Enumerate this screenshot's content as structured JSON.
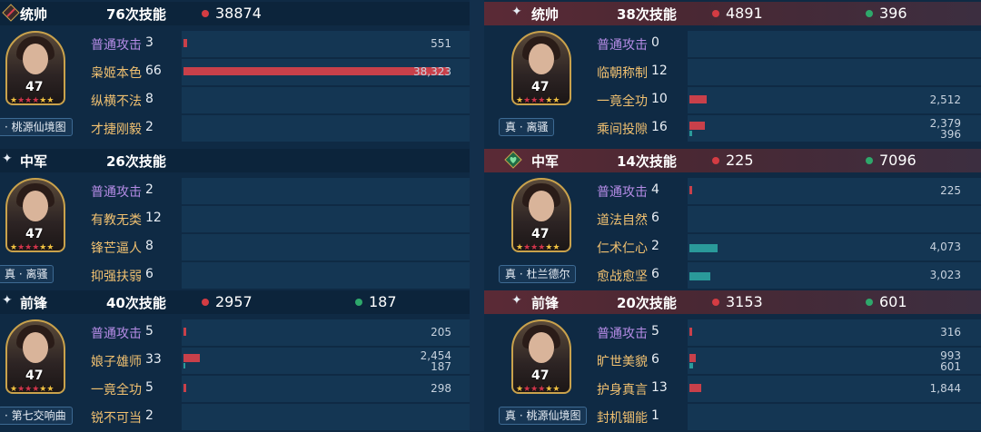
{
  "left": {
    "sections": [
      {
        "role": "统帅",
        "count": "76次技能",
        "red": "38874",
        "green": "",
        "hero": {
          "level": "47",
          "name": "· 桃源仙境图"
        },
        "skills": [
          {
            "name": "普通攻击",
            "count": "3",
            "v1": "551",
            "v2": "",
            "red": 0.013,
            "green": 0
          },
          {
            "name": "枭姬本色",
            "count": "66",
            "v1": "38,323",
            "v2": "",
            "red": 0.95,
            "green": 0
          },
          {
            "name": "纵横不法",
            "count": "8",
            "v1": "",
            "v2": "",
            "red": 0,
            "green": 0
          },
          {
            "name": "才捷刚毅",
            "count": "2",
            "v1": "",
            "v2": "",
            "red": 0,
            "green": 0
          }
        ]
      },
      {
        "role": "中军",
        "count": "26次技能",
        "red": "",
        "green": "",
        "hero": {
          "level": "47",
          "name": "真 · 离骚"
        },
        "skills": [
          {
            "name": "普通攻击",
            "count": "2",
            "v1": "",
            "v2": "",
            "red": 0,
            "green": 0
          },
          {
            "name": "有教无类",
            "count": "12",
            "v1": "",
            "v2": "",
            "red": 0,
            "green": 0
          },
          {
            "name": "锋芒逼人",
            "count": "8",
            "v1": "",
            "v2": "",
            "red": 0,
            "green": 0
          },
          {
            "name": "抑强扶弱",
            "count": "6",
            "v1": "",
            "v2": "",
            "red": 0,
            "green": 0
          }
        ]
      },
      {
        "role": "前锋",
        "count": "40次技能",
        "red": "2957",
        "green": "187",
        "hero": {
          "level": "47",
          "name": "· 第七交响曲"
        },
        "skills": [
          {
            "name": "普通攻击",
            "count": "5",
            "v1": "205",
            "v2": "",
            "red": 0.005,
            "green": 0
          },
          {
            "name": "娘子雄师",
            "count": "33",
            "v1": "2,454",
            "v2": "187",
            "red": 0.06,
            "green": 0.005
          },
          {
            "name": "一竟全功",
            "count": "5",
            "v1": "298",
            "v2": "",
            "red": 0.007,
            "green": 0
          },
          {
            "name": "锐不可当",
            "count": "2",
            "v1": "",
            "v2": "",
            "red": 0,
            "green": 0
          }
        ]
      }
    ]
  },
  "right": {
    "sections": [
      {
        "role": "统帅",
        "count": "38次技能",
        "red": "4891",
        "green": "396",
        "hero": {
          "level": "47",
          "name": "真 · 离骚"
        },
        "skills": [
          {
            "name": "普通攻击",
            "count": "0",
            "v1": "",
            "v2": "",
            "red": 0,
            "green": 0
          },
          {
            "name": "临朝称制",
            "count": "12",
            "v1": "",
            "v2": "",
            "red": 0,
            "green": 0
          },
          {
            "name": "一竟全功",
            "count": "10",
            "v1": "2,512",
            "v2": "",
            "red": 0.06,
            "green": 0
          },
          {
            "name": "乘间投隙",
            "count": "16",
            "v1": "2,379",
            "v2": "396",
            "red": 0.055,
            "green": 0.008
          }
        ]
      },
      {
        "role": "中军",
        "count": "14次技能",
        "red": "225",
        "green": "7096",
        "hero": {
          "level": "47",
          "name": "真 · 杜兰德尔"
        },
        "skills": [
          {
            "name": "普通攻击",
            "count": "4",
            "v1": "225",
            "v2": "",
            "red": 0.005,
            "green": 0
          },
          {
            "name": "道法自然",
            "count": "6",
            "v1": "",
            "v2": "",
            "red": 0,
            "green": 0
          },
          {
            "name": "仁术仁心",
            "count": "2",
            "v1": "4,073",
            "v2": "",
            "red": 0,
            "green": 0.1
          },
          {
            "name": "愈战愈坚",
            "count": "6",
            "v1": "3,023",
            "v2": "",
            "red": 0,
            "green": 0.075
          }
        ]
      },
      {
        "role": "前锋",
        "count": "20次技能",
        "red": "3153",
        "green": "601",
        "hero": {
          "level": "47",
          "name": "真 · 桃源仙境图"
        },
        "skills": [
          {
            "name": "普通攻击",
            "count": "5",
            "v1": "316",
            "v2": "",
            "red": 0.007,
            "green": 0
          },
          {
            "name": "旷世美貌",
            "count": "6",
            "v1": "993",
            "v2": "601",
            "red": 0.022,
            "green": 0.012
          },
          {
            "name": "护身真言",
            "count": "13",
            "v1": "1,844",
            "v2": "",
            "red": 0.04,
            "green": 0
          },
          {
            "name": "封机锢能",
            "count": "1",
            "v1": "",
            "v2": "",
            "red": 0,
            "green": 0
          }
        ]
      }
    ]
  },
  "colors": {
    "damage": "#c8404a",
    "heal": "#2a9a9a",
    "basic_attack": "#b58ce6",
    "skill": "#f0c070"
  }
}
